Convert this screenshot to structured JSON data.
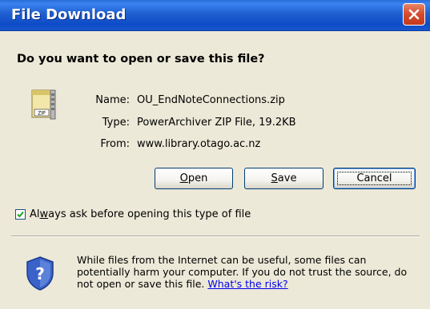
{
  "window": {
    "title": "File Download"
  },
  "dialog": {
    "question": "Do you want to open or save this file?",
    "file": {
      "name_label": "Name:",
      "name_value": "OU_EndNoteConnections.zip",
      "type_label": "Type:",
      "type_value": "PowerArchiver ZIP File, 19.2KB",
      "from_label": "From:",
      "from_value": "www.library.otago.ac.nz",
      "icon_label": "ZIP"
    },
    "buttons": {
      "open_prefix": "",
      "open_mnemonic": "O",
      "open_suffix": "pen",
      "save_prefix": "",
      "save_mnemonic": "S",
      "save_suffix": "ave",
      "cancel": "Cancel"
    },
    "checkbox": {
      "prefix": "Al",
      "mnemonic": "w",
      "suffix": "ays ask before opening this type of file",
      "checked": true
    },
    "warning": {
      "text": "While files from the Internet can be useful, some files can potentially harm your computer. If you do not trust the source, do not open or save this file. ",
      "link": "What's the risk?"
    }
  },
  "colors": {
    "titlebar": "#0d4cc7",
    "close": "#d54a2c",
    "background": "#ece9d8",
    "link": "#0000ee"
  },
  "icons": {
    "file": "zip-file-icon",
    "close": "close-icon",
    "shield": "security-shield-icon",
    "check": "checkmark-icon"
  }
}
